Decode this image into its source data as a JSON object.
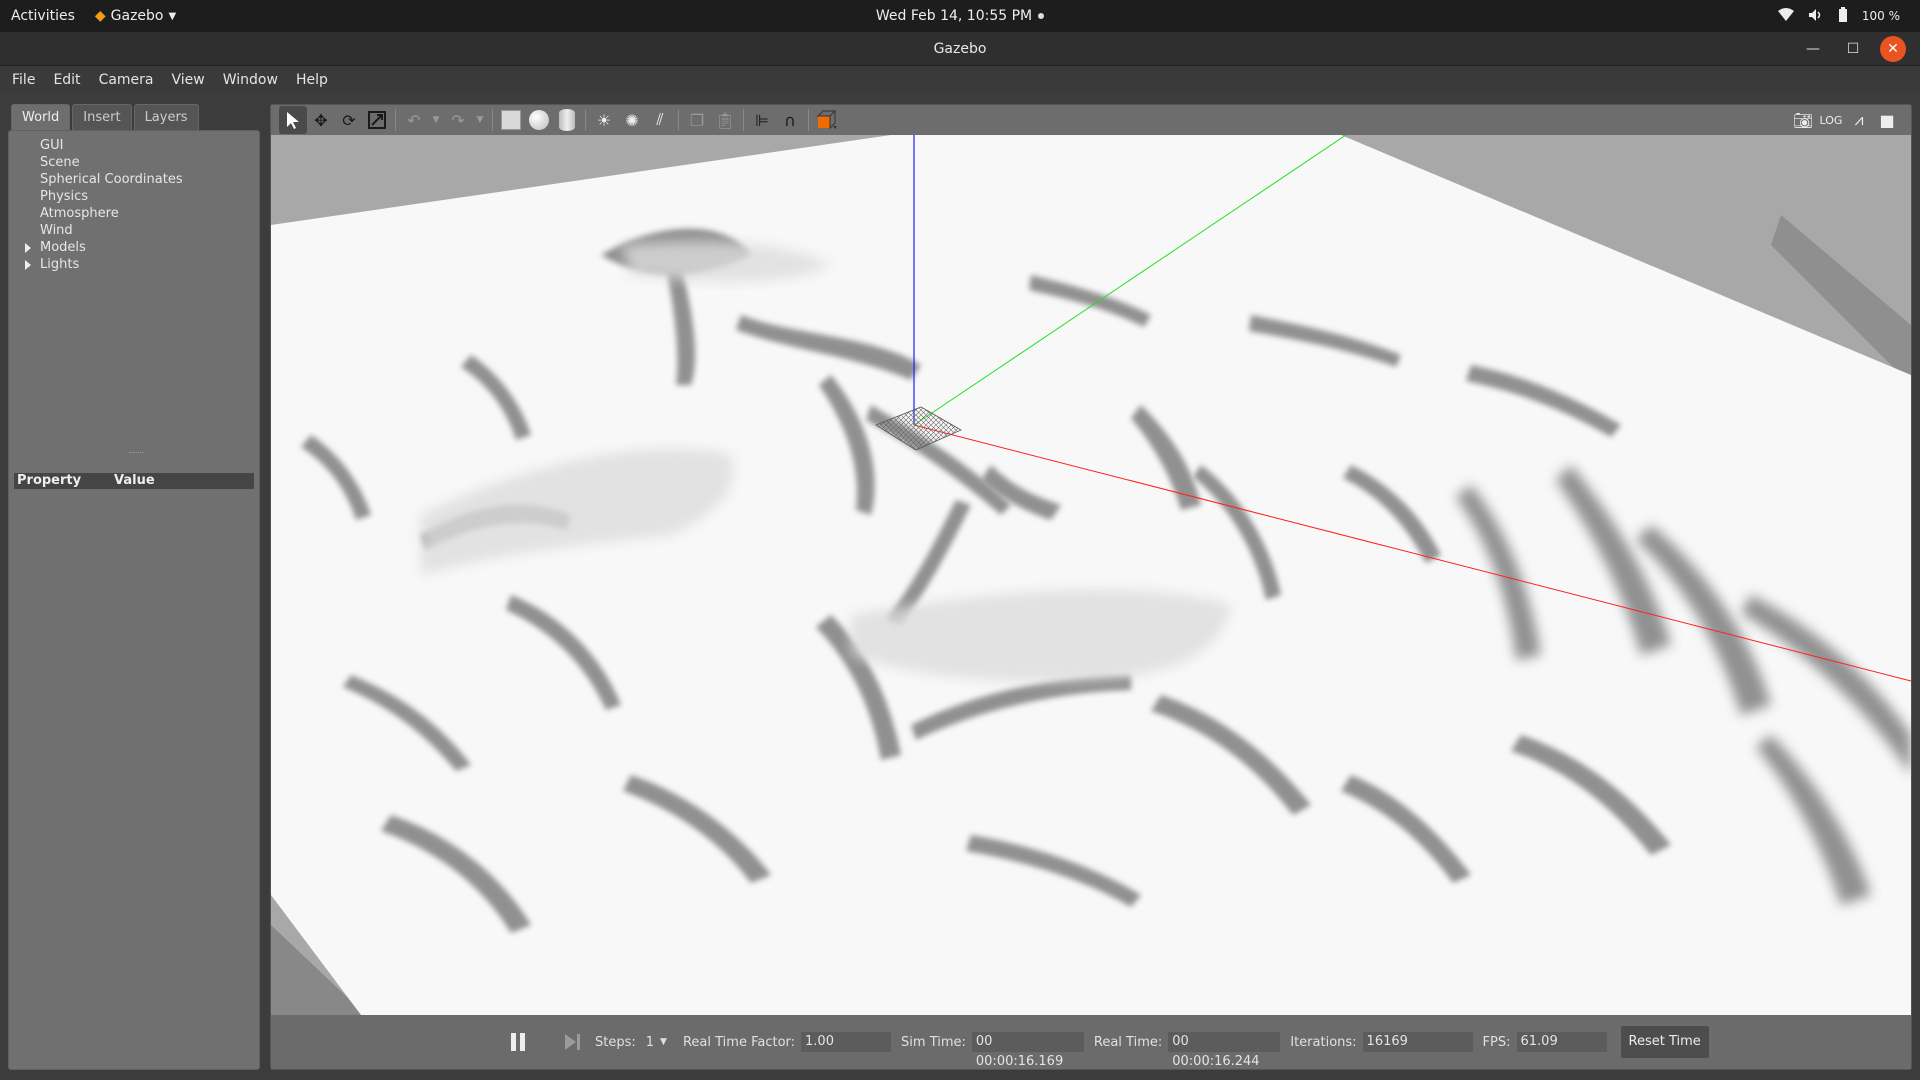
{
  "topbar": {
    "activities": "Activities",
    "app_name": "Gazebo",
    "clock": "Wed Feb 14, 10:55 PM",
    "battery": "100 %"
  },
  "window": {
    "title": "Gazebo"
  },
  "menu": {
    "items": [
      "File",
      "Edit",
      "Camera",
      "View",
      "Window",
      "Help"
    ]
  },
  "left_panel": {
    "tabs": [
      "World",
      "Insert",
      "Layers"
    ],
    "active_tab": "World",
    "tree": [
      "GUI",
      "Scene",
      "Spherical Coordinates",
      "Physics",
      "Atmosphere",
      "Wind",
      "Models",
      "Lights"
    ],
    "property_header": {
      "property": "Property",
      "value": "Value"
    }
  },
  "statusbar": {
    "steps_label": "Steps:",
    "steps_value": "1",
    "rtf_label": "Real Time Factor:",
    "rtf_value": "1.00",
    "sim_time_label": "Sim Time:",
    "sim_time_value": "00 00:00:16.169",
    "real_time_label": "Real Time:",
    "real_time_value": "00 00:00:16.244",
    "iterations_label": "Iterations:",
    "iterations_value": "16169",
    "fps_label": "FPS:",
    "fps_value": "61.09",
    "reset_time": "Reset Time"
  },
  "colors": {
    "x_axis": "#ff2020",
    "y_axis": "#20e020",
    "z_axis": "#2020ff",
    "accent": "#e95420",
    "ground": "#f6f6f6"
  }
}
